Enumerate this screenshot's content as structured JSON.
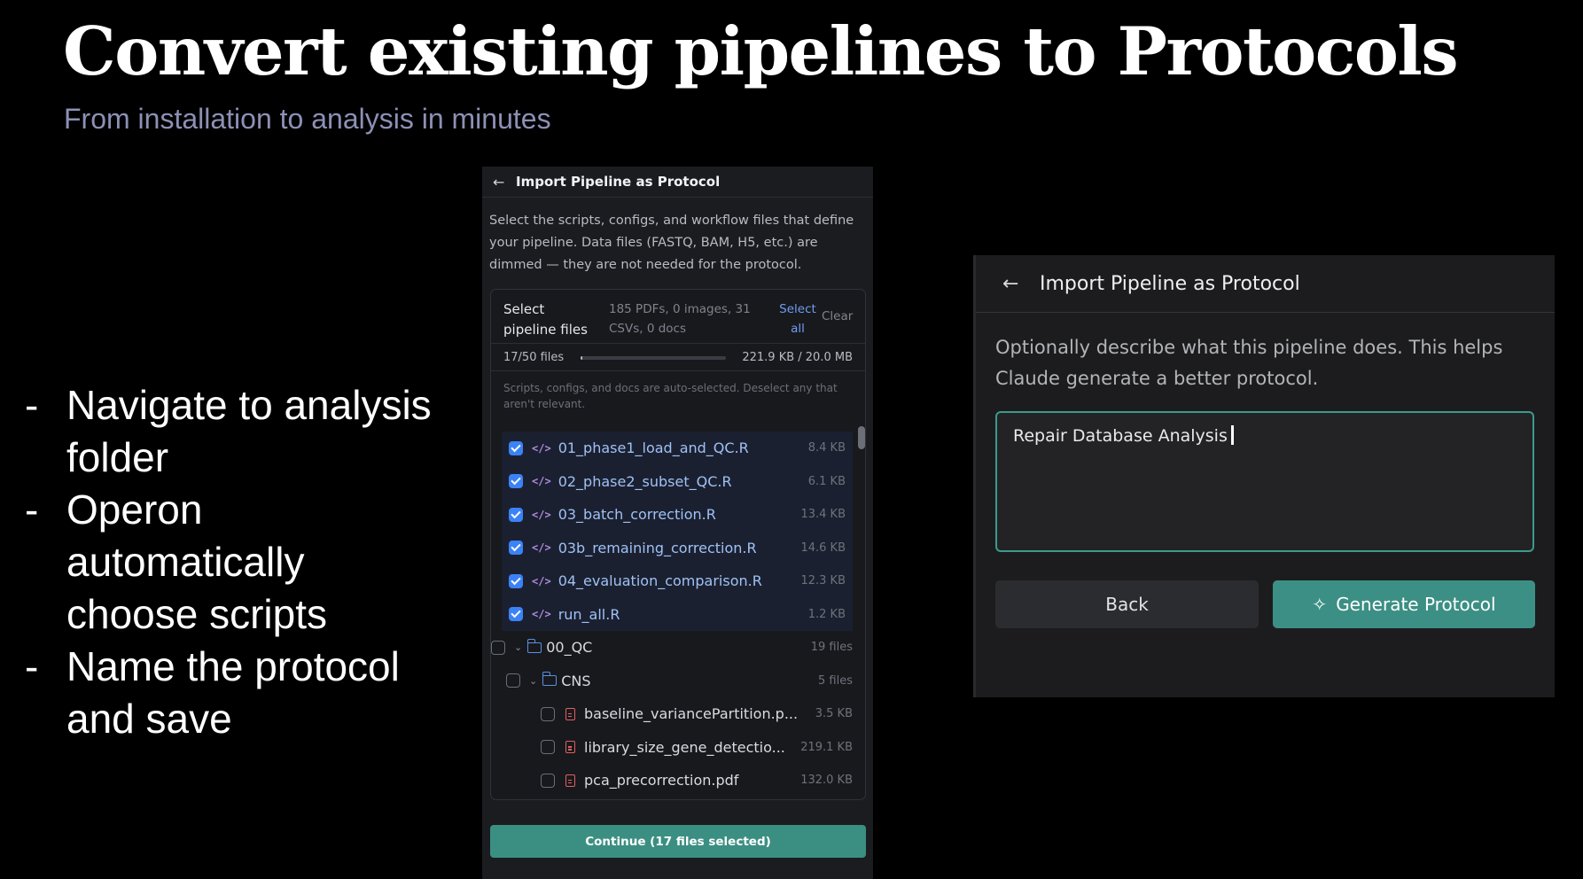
{
  "slide": {
    "title": "Convert existing pipelines to Protocols",
    "subtitle": "From installation to analysis in minutes",
    "bullets": [
      "Navigate to analysis folder",
      "Operon automatically choose scripts",
      "Name the protocol and save"
    ]
  },
  "file_picker": {
    "header_title": "Import Pipeline as Protocol",
    "description": "Select the scripts, configs, and workflow files that define your pipeline. Data files (FASTQ, BAM, H5, etc.) are dimmed — they are not needed for the protocol.",
    "box_heading": "Select pipeline files",
    "stats": "185 PDFs, 0 images, 31 CSVs, 0 docs",
    "select_all": "Select all",
    "clear": "Clear",
    "file_count": "17/50 files",
    "progress_fraction": 0.011,
    "size_summary": "221.9 KB / 20.0 MB",
    "note": "Scripts, configs, and docs are auto-selected. Deselect any that aren't relevant.",
    "selected_files": [
      {
        "name": "01_phase1_load_and_QC.R",
        "size": "8.4 KB",
        "checked": true
      },
      {
        "name": "02_phase2_subset_QC.R",
        "size": "6.1 KB",
        "checked": true
      },
      {
        "name": "03_batch_correction.R",
        "size": "13.4 KB",
        "checked": true
      },
      {
        "name": "03b_remaining_correction.R",
        "size": "14.6 KB",
        "checked": true
      },
      {
        "name": "04_evaluation_comparison.R",
        "size": "12.3 KB",
        "checked": true
      },
      {
        "name": "run_all.R",
        "size": "1.2 KB",
        "checked": true
      }
    ],
    "folder_qc": {
      "name": "00_QC",
      "count": "19 files"
    },
    "folder_cns": {
      "name": "CNS",
      "count": "5 files"
    },
    "pdf_files": [
      {
        "name": "baseline_variancePartition.p...",
        "size": "3.5 KB"
      },
      {
        "name": "library_size_gene_detectio...",
        "size": "219.1 KB"
      },
      {
        "name": "pca_precorrection.pdf",
        "size": "132.0 KB"
      }
    ],
    "continue_label": "Continue (17 files selected)"
  },
  "name_step": {
    "header_title": "Import Pipeline as Protocol",
    "description": "Optionally describe what this pipeline does. This helps Claude generate a better protocol.",
    "input_value": "Repair Database Analysis",
    "back_label": "Back",
    "generate_label": "Generate Protocol"
  },
  "colors": {
    "accent": "#3c8f84",
    "checkbox": "#3b82f6",
    "subtitle": "#8d90b5"
  }
}
